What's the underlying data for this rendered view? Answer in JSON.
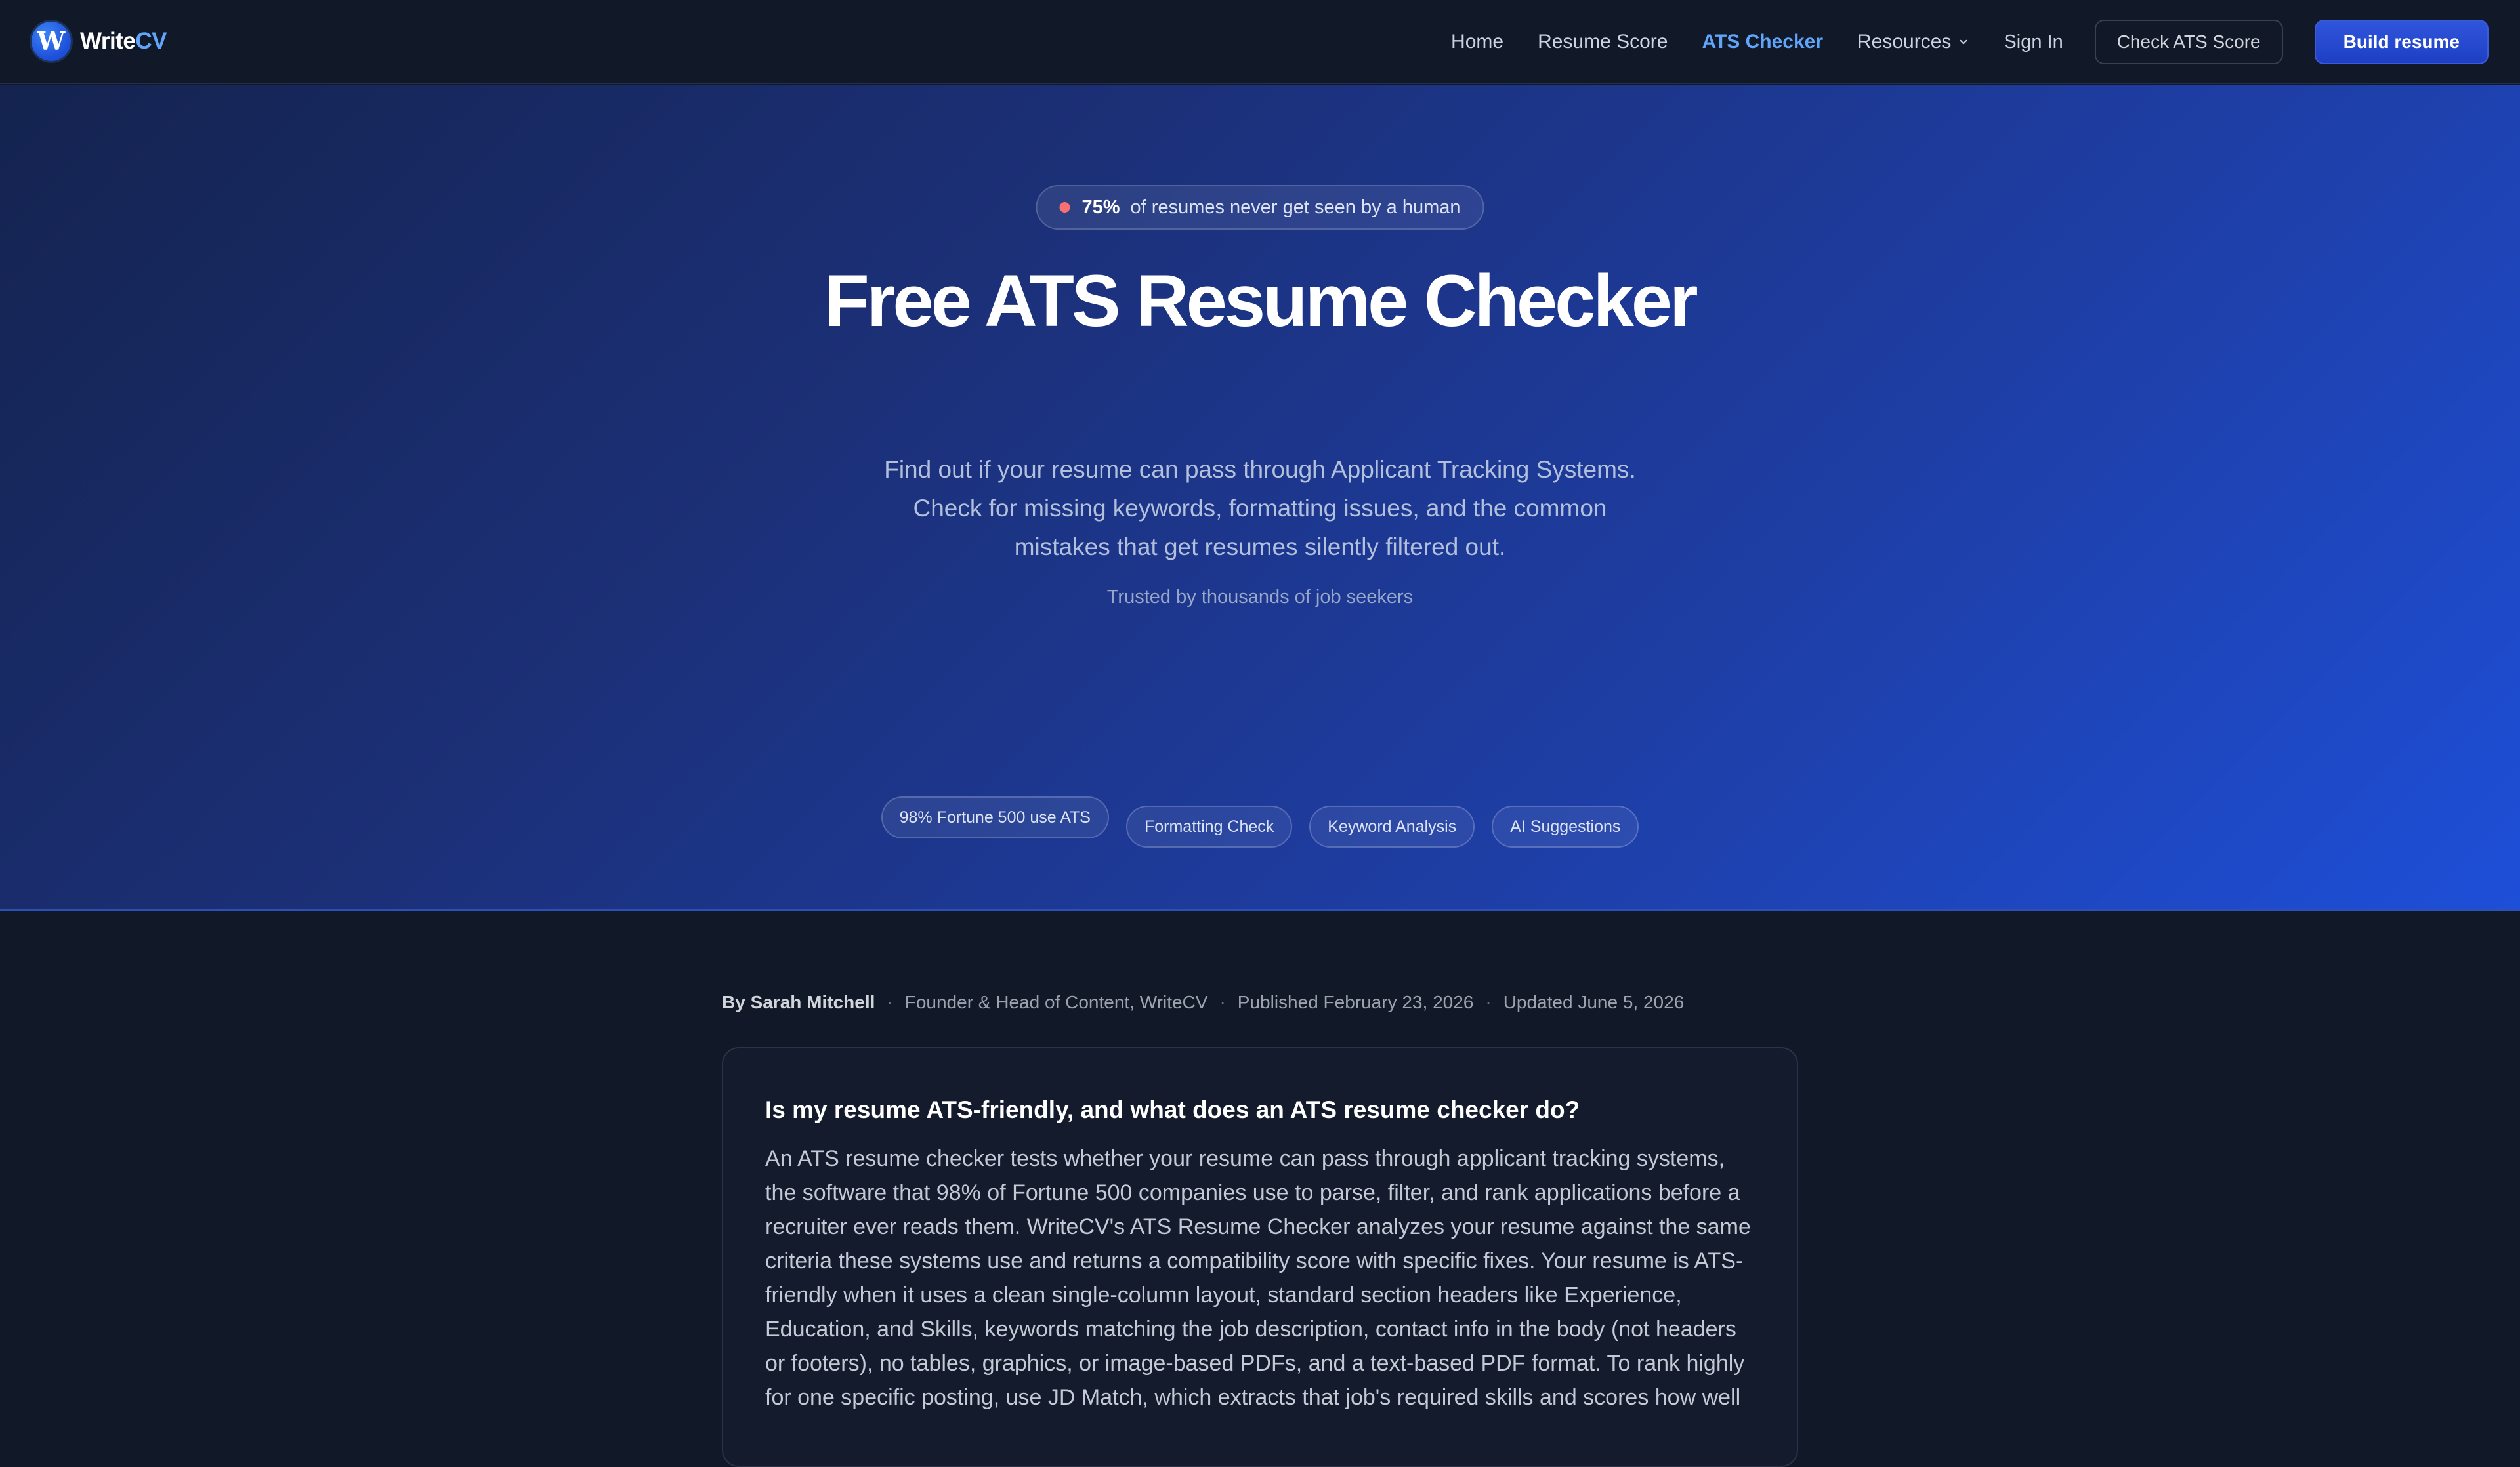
{
  "brand": {
    "name_part1": "Write",
    "name_part2": "CV",
    "mark_letter": "W"
  },
  "nav": {
    "links": [
      {
        "label": "Home"
      },
      {
        "label": "Resume Score"
      },
      {
        "label": "ATS Checker",
        "active": true
      },
      {
        "label": "Resources",
        "has_dropdown": true
      }
    ],
    "sign_in": "Sign In",
    "check_ats_button": "Check ATS Score",
    "build_button": "Build resume"
  },
  "hero": {
    "stat_value": "75%",
    "stat_text": "of resumes never get seen by a human",
    "title": "Free ATS Resume Checker",
    "subtitle": "Find out if your resume can pass through Applicant Tracking Systems. Check for missing keywords, formatting issues, and the common mistakes that get resumes silently filtered out.",
    "trust": "Trusted by thousands of job seekers",
    "tags": [
      "98% Fortune 500 use ATS",
      "Formatting Check",
      "Keyword Analysis",
      "AI Suggestions"
    ]
  },
  "article": {
    "author": "By Sarah Mitchell",
    "role": "Founder & Head of Content, WriteCV",
    "published": "Published February 23, 2026",
    "updated": "Updated June 5, 2026",
    "separator": "·",
    "faq_title": "Is my resume ATS-friendly, and what does an ATS resume checker do?",
    "faq_body": "An ATS resume checker tests whether your resume can pass through applicant tracking systems, the software that 98% of Fortune 500 companies use to parse, filter, and rank applications before a recruiter ever reads them. WriteCV's ATS Resume Checker analyzes your resume against the same criteria these systems use and returns a compatibility score with specific fixes. Your resume is ATS-friendly when it uses a clean single-column layout, standard section headers like Experience, Education, and Skills, keywords matching the job description, contact info in the body (not headers or footers), no tables, graphics, or image-based PDFs, and a text-based PDF format. To rank highly for one specific posting, use JD Match, which extracts that job's required skills and scores how well"
  },
  "colors": {
    "background": "#111827",
    "accent": "#60a5fa",
    "primary_button": "#1e3fc4",
    "stat_dot": "#f87171"
  },
  "icons": {
    "logo": "writecv-logo-icon",
    "dropdown": "chevron-down-icon",
    "stat": "status-dot-icon"
  }
}
